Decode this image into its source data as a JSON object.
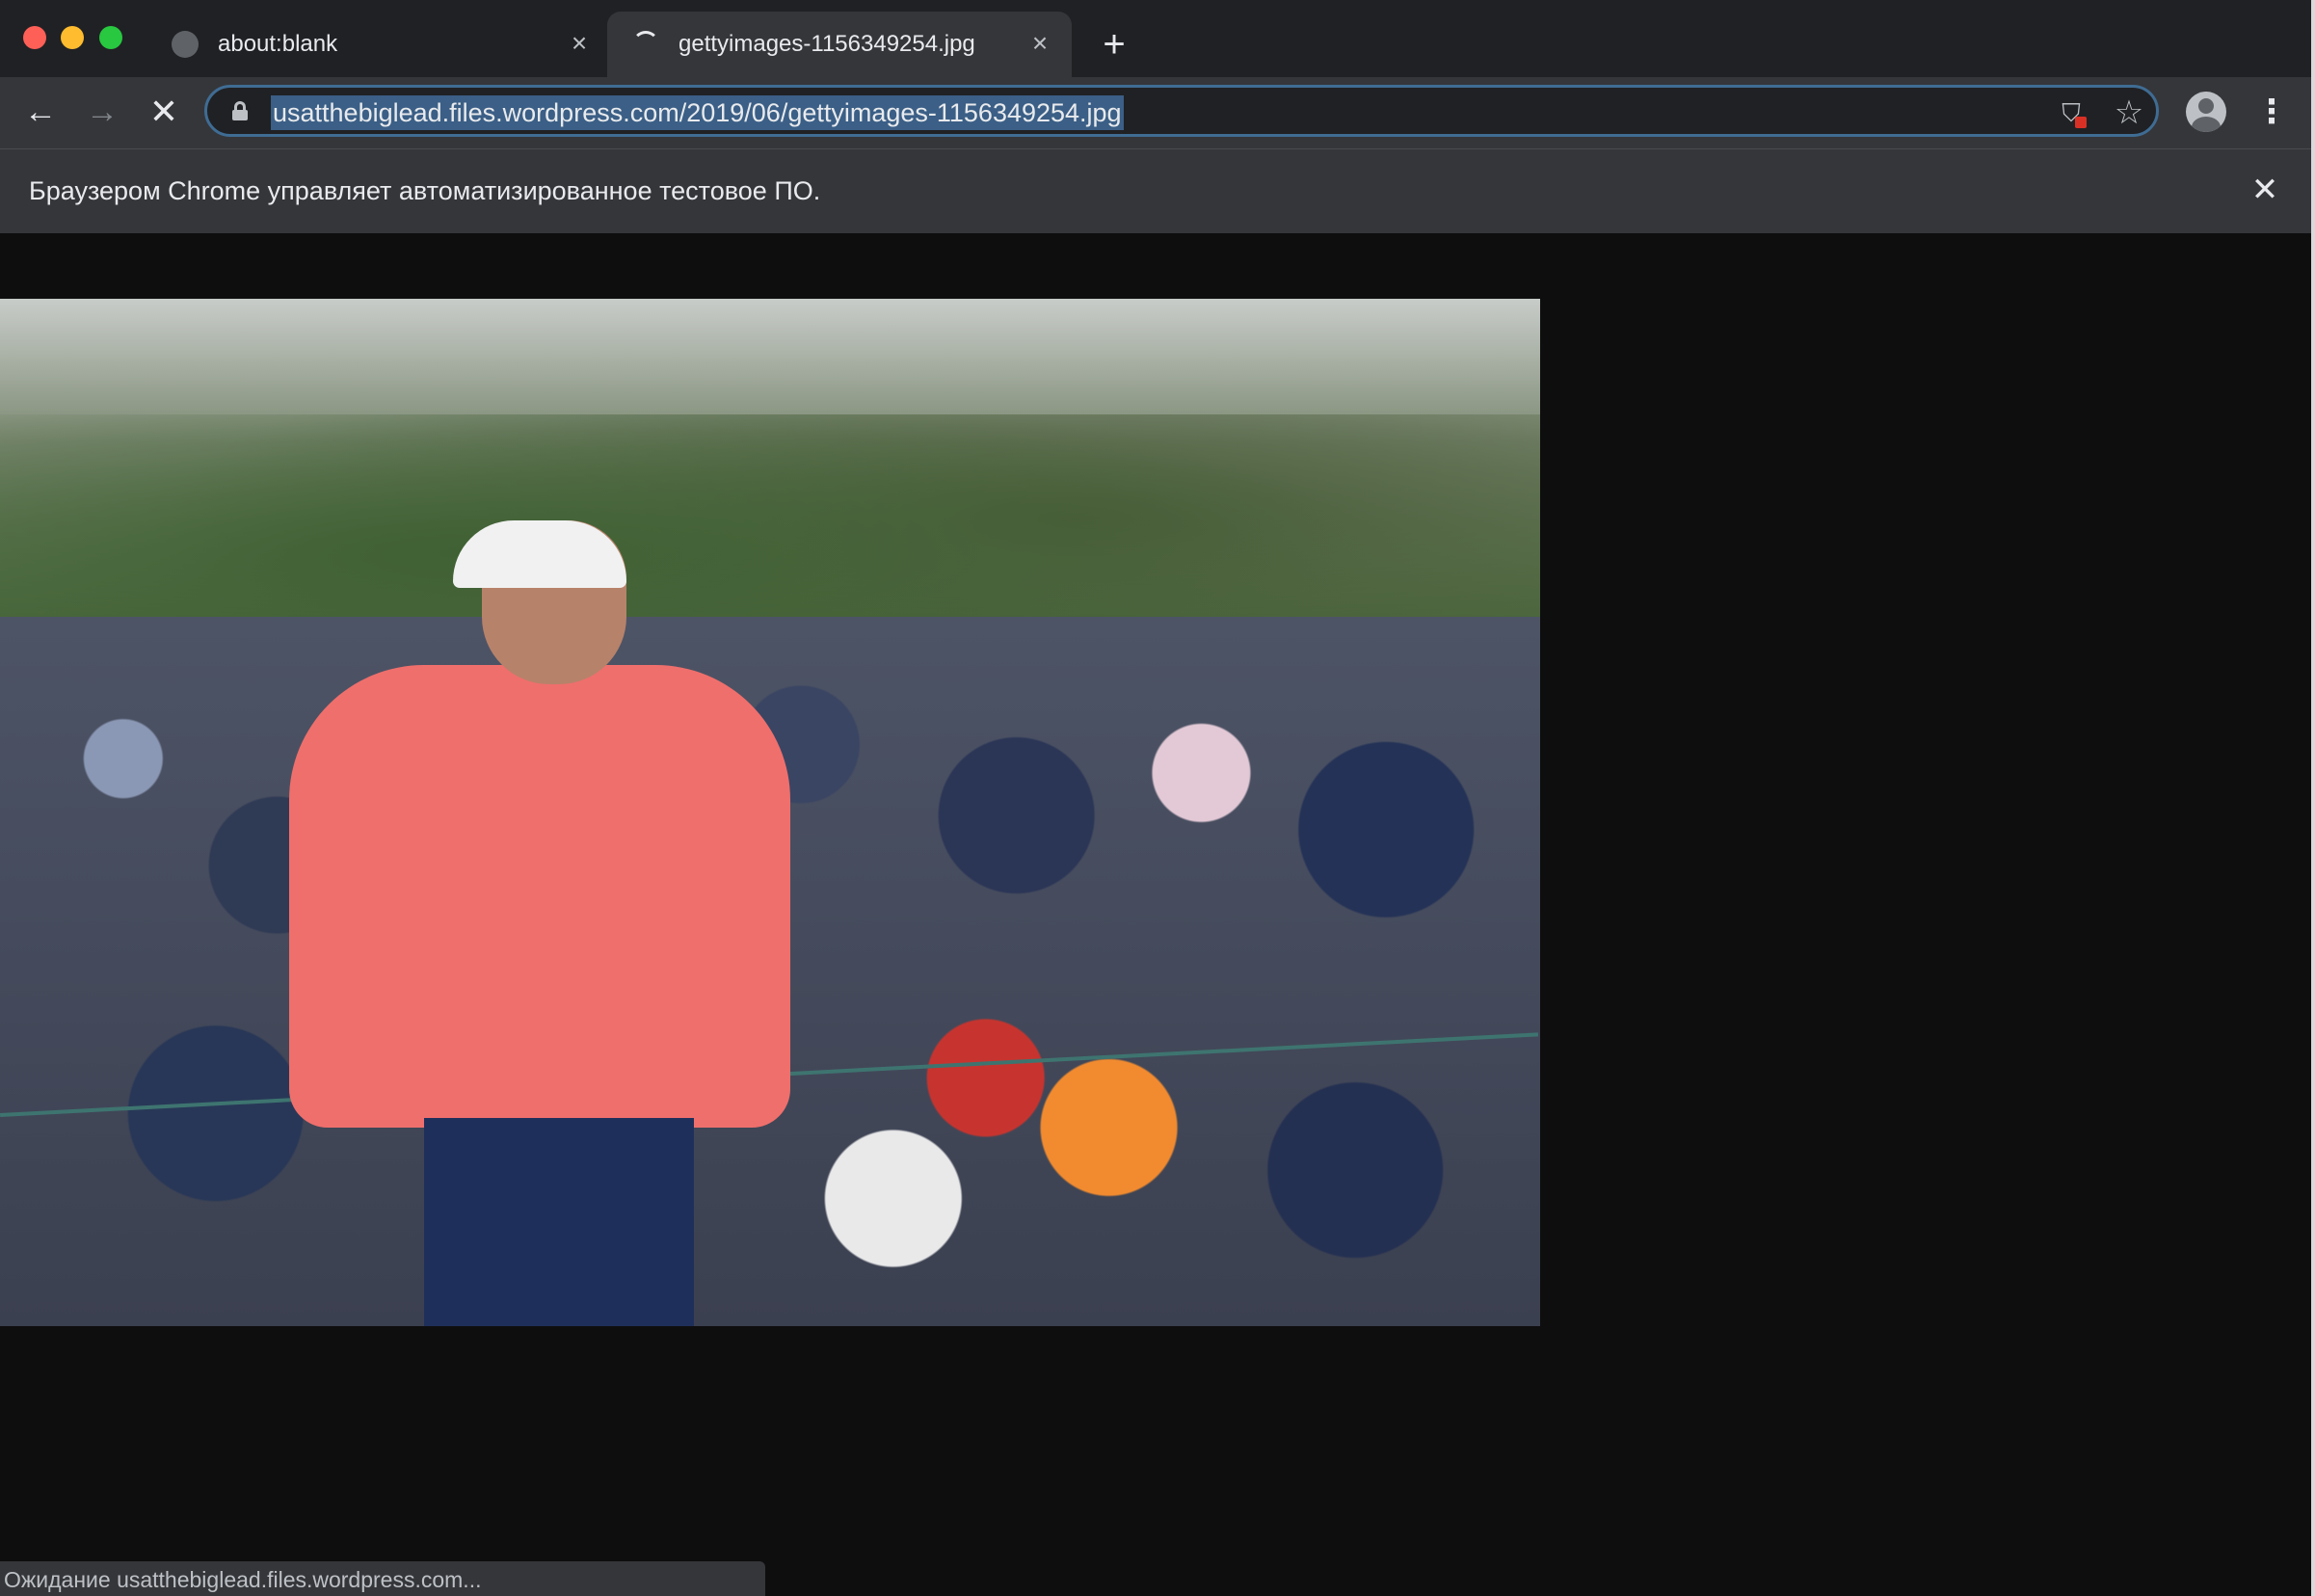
{
  "window": {
    "traffic_lights": {
      "close": "#fe5f57",
      "minimize": "#febc2e",
      "zoom": "#28c840"
    }
  },
  "tabs": [
    {
      "title": "about:blank",
      "icon": "globe-icon",
      "active": false
    },
    {
      "title": "gettyimages-1156349254.jpg",
      "icon": "loading-spinner-icon",
      "active": true
    }
  ],
  "toolbar": {
    "back_icon": "←",
    "forward_icon": "→",
    "stop_icon": "✕",
    "url": "usatthebiglead.files.wordpress.com/2019/06/gettyimages-1156349254.jpg",
    "url_selected": true,
    "bookmark_icon": "☆",
    "menu_icon": "⋮"
  },
  "infobar": {
    "message": "Браузером Chrome управляет автоматизированное тестовое ПО.",
    "close_icon": "✕"
  },
  "content": {
    "image_file": "gettyimages-1156349254.jpg"
  },
  "status_bar": {
    "text": "Ожидание usatthebiglead.files.wordpress.com..."
  },
  "colors": {
    "tabstrip_bg": "#202124",
    "toolbar_bg": "#35363a",
    "page_bg": "#0e0e0f",
    "url_selection": "#3b5f86",
    "omnibox_focus_ring": "#3f6c93"
  }
}
